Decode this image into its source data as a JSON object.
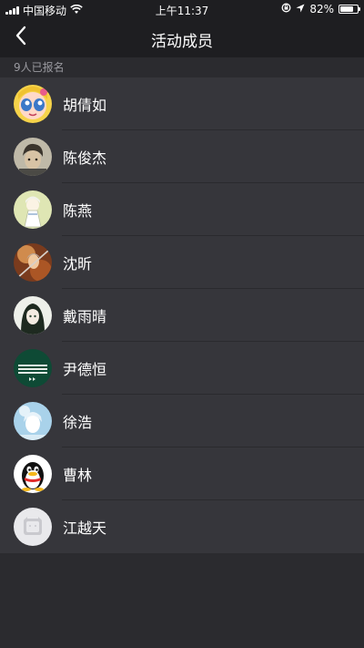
{
  "status_bar": {
    "carrier": "中国移动",
    "time": "上午11:37",
    "battery_percent": "82%",
    "battery_level": 0.82,
    "icons": [
      "signal-icon",
      "wifi-icon",
      "rotation-lock-icon",
      "location-icon",
      "battery-icon"
    ]
  },
  "nav": {
    "title": "活动成员",
    "back_icon": "chevron-left-icon"
  },
  "section": {
    "header": "9人已报名"
  },
  "members": [
    {
      "name": "胡倩如",
      "avatar": "powerpuff-avatar"
    },
    {
      "name": "陈俊杰",
      "avatar": "portrait-avatar"
    },
    {
      "name": "陈燕",
      "avatar": "anime-girl-avatar"
    },
    {
      "name": "沈昕",
      "avatar": "warrior-avatar"
    },
    {
      "name": "戴雨晴",
      "avatar": "anime-girl-dark-avatar"
    },
    {
      "name": "尹德恒",
      "avatar": "green-logo-avatar"
    },
    {
      "name": "徐浩",
      "avatar": "winter-avatar"
    },
    {
      "name": "曹林",
      "avatar": "qq-penguin-avatar"
    },
    {
      "name": "江越天",
      "avatar": "default-avatar"
    }
  ],
  "colors": {
    "background": "#2b2b2f",
    "list_background": "#36363b",
    "nav_background": "#1e1e21",
    "section_text": "#9a9aa0",
    "text": "#ffffff"
  }
}
